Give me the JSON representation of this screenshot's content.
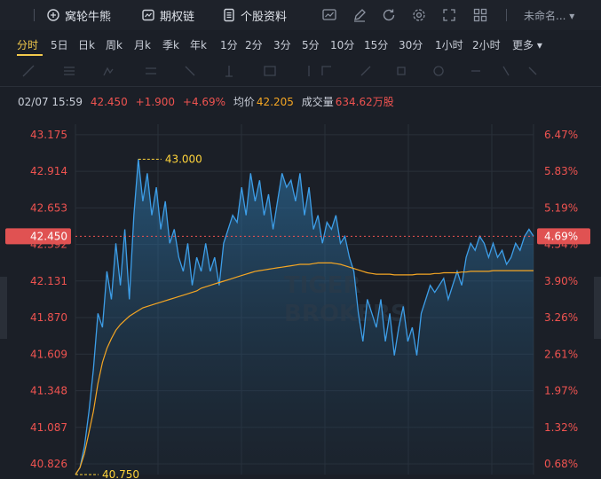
{
  "toolbar": {
    "items": [
      {
        "label": "窝轮牛熊",
        "icon": "warrant-icon"
      },
      {
        "label": "期权链",
        "icon": "options-chain-icon"
      },
      {
        "label": "个股资料",
        "icon": "document-icon"
      }
    ],
    "icons": [
      "chart-icon",
      "draw-icon",
      "refresh-icon",
      "settings-icon",
      "expand-icon",
      "grid-icon"
    ],
    "account": "未命名... ▾"
  },
  "tabs": [
    "分时",
    "5日",
    "日k",
    "周k",
    "月k",
    "季k",
    "年k",
    "1分",
    "2分",
    "3分",
    "5分",
    "10分",
    "15分",
    "30分",
    "1小时",
    "2小时",
    "更多 ▾"
  ],
  "active_tab": "分时",
  "quote": {
    "datetime": "02/07 15:59",
    "price": "42.450",
    "change": "+1.900",
    "change_pct": "+4.69%",
    "avg_label": "均价",
    "avg_value": "42.205",
    "volume_label": "成交量",
    "volume_value": "634.62万股"
  },
  "colors": {
    "up": "#ef5350",
    "price_line": "#3d9ee8",
    "avg_line": "#f5a623",
    "marker": "#ffd43b",
    "axis_left": "#ef5350",
    "axis_right": "#ef5350"
  },
  "chart_data": {
    "type": "line",
    "y_ticks_left": [
      "43.175",
      "42.914",
      "42.653",
      "42.392",
      "42.131",
      "41.870",
      "41.609",
      "41.348",
      "41.087",
      "40.826"
    ],
    "y_ticks_right": [
      "6.47%",
      "5.83%",
      "5.19%",
      "4.54%",
      "3.90%",
      "3.26%",
      "2.61%",
      "1.97%",
      "1.32%",
      "0.68%"
    ],
    "current_price_label": "42.450",
    "current_pct_label": "4.69%",
    "high_label": "43.000",
    "low_label": "40.750",
    "ylim": [
      40.75,
      43.25
    ],
    "series": [
      {
        "values": [
          40.75,
          40.8,
          40.95,
          41.2,
          41.5,
          41.9,
          41.8,
          42.2,
          42.0,
          42.4,
          42.1,
          42.5,
          42.0,
          42.6,
          43.0,
          42.7,
          42.9,
          42.6,
          42.8,
          42.5,
          42.7,
          42.4,
          42.5,
          42.3,
          42.2,
          42.4,
          42.1,
          42.3,
          42.2,
          42.4,
          42.2,
          42.3,
          42.1,
          42.4,
          42.5,
          42.6,
          42.55,
          42.8,
          42.6,
          42.9,
          42.7,
          42.85,
          42.6,
          42.75,
          42.5,
          42.7,
          42.9,
          42.8,
          42.85,
          42.7,
          42.9,
          42.6,
          42.8,
          42.5,
          42.6,
          42.4,
          42.55,
          42.5,
          42.6,
          42.4,
          42.45,
          42.3,
          42.2,
          41.9,
          41.7,
          42.0,
          41.9,
          41.8,
          42.0,
          41.7,
          41.9,
          41.6,
          41.8,
          41.95,
          41.7,
          41.8,
          41.6,
          41.9,
          42.0,
          42.1,
          42.05,
          42.1,
          42.15,
          42.0,
          42.1,
          42.2,
          42.1,
          42.3,
          42.4,
          42.35,
          42.45,
          42.4,
          42.3,
          42.4,
          42.3,
          42.35,
          42.25,
          42.3,
          42.4,
          42.35,
          42.45,
          42.5,
          42.45
        ]
      },
      {
        "values": [
          40.75,
          40.8,
          40.9,
          41.05,
          41.2,
          41.4,
          41.55,
          41.65,
          41.72,
          41.78,
          41.82,
          41.85,
          41.88,
          41.9,
          41.92,
          41.94,
          41.95,
          41.96,
          41.97,
          41.98,
          41.99,
          42.0,
          42.01,
          42.02,
          42.03,
          42.04,
          42.05,
          42.06,
          42.08,
          42.09,
          42.1,
          42.11,
          42.12,
          42.13,
          42.14,
          42.15,
          42.16,
          42.17,
          42.18,
          42.19,
          42.2,
          42.205,
          42.21,
          42.215,
          42.22,
          42.225,
          42.23,
          42.235,
          42.24,
          42.245,
          42.25,
          42.25,
          42.25,
          42.255,
          42.26,
          42.26,
          42.26,
          42.26,
          42.255,
          42.25,
          42.24,
          42.23,
          42.22,
          42.21,
          42.2,
          42.19,
          42.185,
          42.18,
          42.18,
          42.18,
          42.18,
          42.175,
          42.175,
          42.175,
          42.175,
          42.175,
          42.18,
          42.18,
          42.18,
          42.18,
          42.185,
          42.185,
          42.19,
          42.19,
          42.19,
          42.19,
          42.195,
          42.195,
          42.2,
          42.2,
          42.2,
          42.2,
          42.2,
          42.205,
          42.205,
          42.205,
          42.205,
          42.205,
          42.205,
          42.205,
          42.205,
          42.205,
          42.205
        ]
      }
    ]
  }
}
